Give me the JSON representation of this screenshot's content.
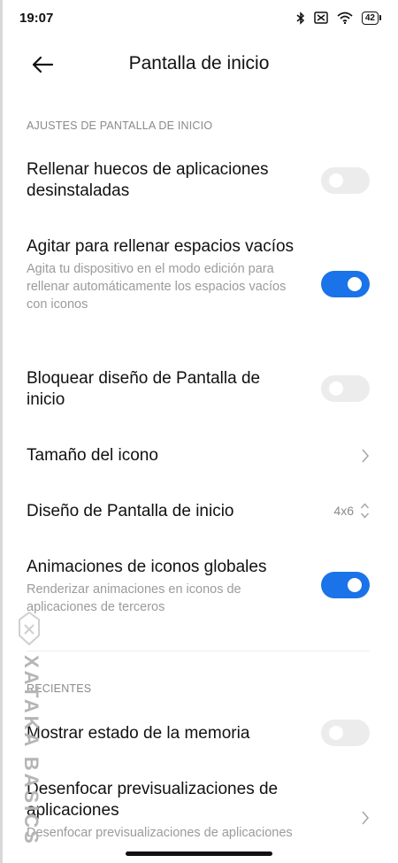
{
  "status": {
    "time": "19:07",
    "battery": "42"
  },
  "header": {
    "title": "Pantalla de inicio"
  },
  "sections": {
    "home": "AJUSTES DE PANTALLA DE INICIO",
    "recents": "RECIENTES"
  },
  "rows": {
    "fill_gaps": {
      "title": "Rellenar huecos de aplicaciones desinstaladas",
      "enabled": false
    },
    "shake_fill": {
      "title": "Agitar para rellenar espacios vacíos",
      "desc": "Agita tu dispositivo en el modo edición para rellenar automáticamente los espacios vacíos con iconos",
      "enabled": true
    },
    "lock_layout": {
      "title": "Bloquear diseño de Pantalla de inicio",
      "enabled": false
    },
    "icon_size": {
      "title": "Tamaño del icono"
    },
    "layout": {
      "title": "Diseño de Pantalla de inicio",
      "value": "4x6"
    },
    "global_anim": {
      "title": "Animaciones de iconos globales",
      "desc": "Renderizar animaciones en iconos de aplicaciones de terceros",
      "enabled": true
    },
    "memory_status": {
      "title": "Mostrar estado de la memoria",
      "enabled": false
    },
    "blur_previews": {
      "title": "Desenfocar previsualizaciones de aplicaciones",
      "desc": "Desenfocar previsualizaciones de aplicaciones"
    }
  },
  "watermark": {
    "text": "XATAKA BASICS"
  },
  "colors": {
    "accent": "#1a73e8",
    "toggle_off": "#ececec"
  },
  "icons": [
    "bluetooth-icon",
    "sim-off-icon",
    "wifi-icon",
    "battery-icon",
    "back-arrow-icon",
    "chevron-right-icon",
    "chevron-updown-icon"
  ]
}
